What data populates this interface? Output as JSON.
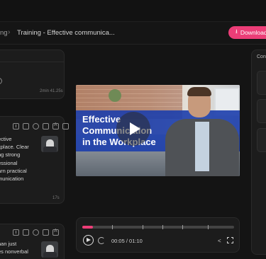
{
  "breadcrumb": {
    "previous": "ng",
    "separator": "›",
    "current": "Training - Effective communica..."
  },
  "header": {
    "download_label": "Download",
    "accent_color": "#ec3d77"
  },
  "cards": [
    {
      "duration": "2min 41.25s"
    },
    {
      "lines": [
        "ective",
        "kplace. Clear",
        "ng strong",
        "essional",
        "arn practical",
        "munication"
      ],
      "time": "17s"
    },
    {
      "lines": [
        "han just",
        "es nonverbal"
      ]
    }
  ],
  "video": {
    "title_line1": "Effective",
    "title_line2": "Communication",
    "title_line3": "in the Workplace"
  },
  "player": {
    "progress_fraction": 0.07,
    "current_time": "00:05",
    "total_time": "01:10",
    "time_display": "00:05 / 01:10"
  },
  "right_panel": {
    "title": "Con"
  }
}
